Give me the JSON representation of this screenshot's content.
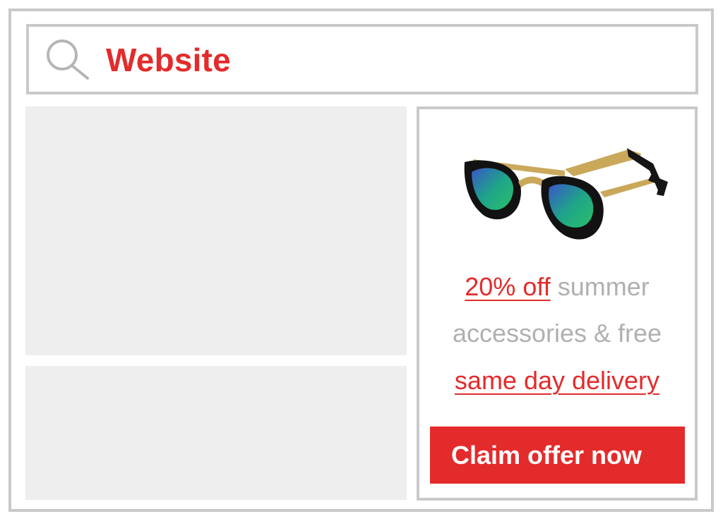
{
  "header": {
    "site_title": "Website",
    "search_icon": "search-icon"
  },
  "ad": {
    "product_image": "sunglasses-image",
    "promo_line1_accent": "20% off",
    "promo_line1_rest": " summer",
    "promo_line2": "accessories & free",
    "promo_line3_accent": "same day delivery",
    "cta_label": "Claim offer now"
  },
  "colors": {
    "accent": "#e32b2b",
    "border": "#c9c9c9",
    "placeholder_block": "#eeeeee",
    "muted_text": "#b0b0b0"
  }
}
